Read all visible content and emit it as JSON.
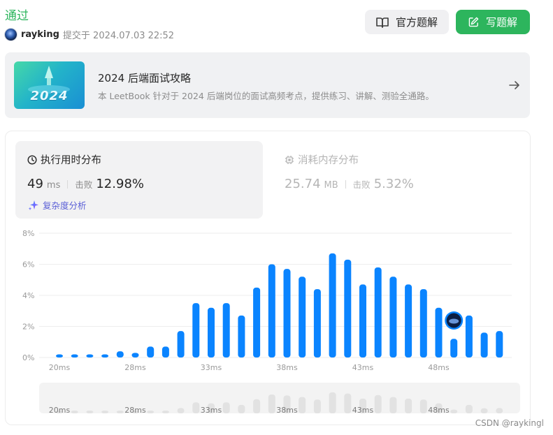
{
  "header": {
    "status": "通过",
    "username": "rayking",
    "submitted_text": "提交于 2024.07.03 22:52"
  },
  "buttons": {
    "official": "官方题解",
    "write": "写题解"
  },
  "banner": {
    "image_text": "2024",
    "title": "2024 后端面试攻略",
    "description": "本 LeetBook 针对于 2024 后端岗位的面试高频考点，提供练习、讲解、测验全通路。"
  },
  "runtime": {
    "title": "执行用时分布",
    "value": "49",
    "unit": "ms",
    "beats_label": "击败",
    "beats": "12.98%",
    "complexity_label": "复杂度分析"
  },
  "memory": {
    "title": "消耗内存分布",
    "value": "25.74",
    "unit": "MB",
    "beats_label": "击败",
    "beats": "5.32%"
  },
  "colors": {
    "accent": "#2db55d",
    "bar": "#0a84ff",
    "bar_dim": "#e2e2e2"
  },
  "chart_data": {
    "type": "bar",
    "y_ticks": [
      "8%",
      "6%",
      "4%",
      "2%",
      "0%"
    ],
    "ylim": [
      0,
      8
    ],
    "x_ticks": [
      "20ms",
      "28ms",
      "33ms",
      "38ms",
      "43ms",
      "48ms"
    ],
    "values": [
      0.2,
      0.2,
      0.2,
      0.2,
      0.4,
      0.3,
      0.7,
      0.7,
      1.7,
      3.5,
      3.2,
      3.5,
      2.7,
      4.5,
      6.0,
      5.7,
      5.2,
      4.4,
      6.7,
      6.3,
      4.7,
      5.8,
      5.2,
      4.7,
      4.4,
      3.2,
      1.2,
      2.7,
      1.6,
      1.7
    ],
    "current_index": 26
  },
  "watermark": "CSDN @raykingl"
}
